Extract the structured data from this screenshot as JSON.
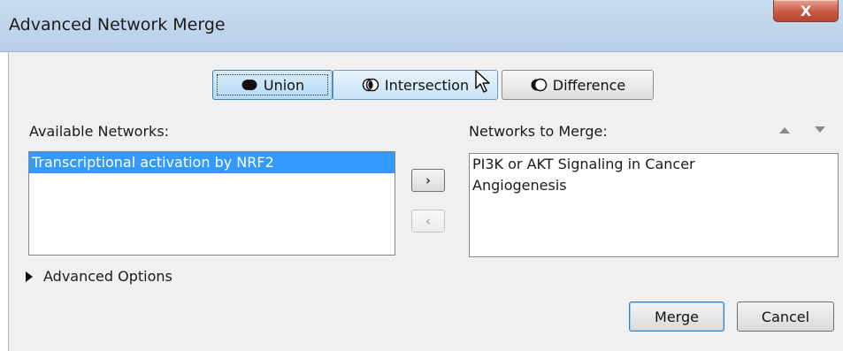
{
  "window": {
    "title": "Advanced Network Merge",
    "close_glyph": "X"
  },
  "modes": {
    "union": "Union",
    "intersection": "Intersection",
    "difference": "Difference"
  },
  "available": {
    "label": "Available Networks:",
    "items": [
      "Transcriptional activation by NRF2"
    ],
    "selected_index": 0
  },
  "to_merge": {
    "label": "Networks to Merge:",
    "items": [
      "PI3K or AKT Signaling in Cancer",
      "Angiogenesis"
    ]
  },
  "transfer": {
    "add": "›",
    "remove": "‹"
  },
  "advanced_options": "Advanced Options",
  "actions": {
    "merge": "Merge",
    "cancel": "Cancel"
  },
  "icons": {
    "union": "union-icon",
    "intersection": "intersection-icon",
    "difference": "difference-icon",
    "move_up": "arrow-up-icon",
    "move_down": "arrow-down-icon",
    "expand": "triangle-right-icon",
    "cursor": "mouse-pointer-icon"
  },
  "colors": {
    "selection": "#3399ff",
    "titlebar": "#c9dcf0",
    "close": "#c75a43"
  }
}
